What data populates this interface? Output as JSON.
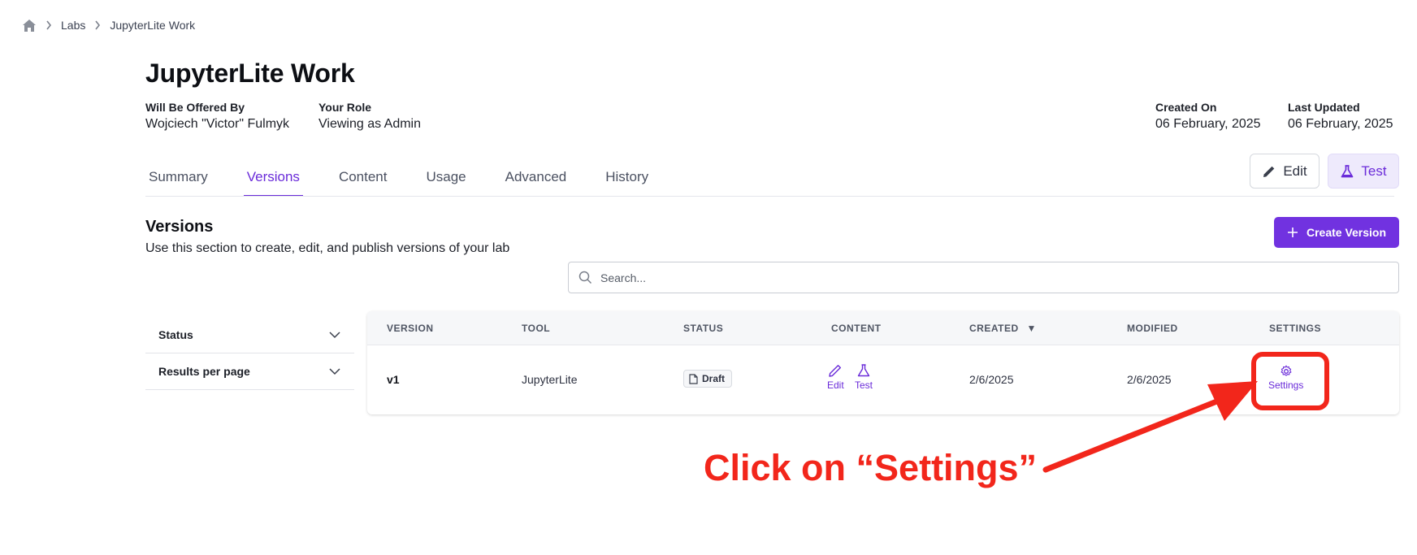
{
  "breadcrumb": {
    "home_icon": "home-icon",
    "items": [
      "Labs",
      "JupyterLite Work"
    ]
  },
  "page": {
    "title": "JupyterLite Work"
  },
  "meta": {
    "offered_by_label": "Will Be Offered By",
    "offered_by_value": "Wojciech \"Victor\" Fulmyk",
    "role_label": "Your Role",
    "role_value": "Viewing as Admin",
    "created_label": "Created On",
    "created_value": "06 February, 2025",
    "updated_label": "Last Updated",
    "updated_value": "06 February, 2025"
  },
  "tabs": [
    {
      "label": "Summary",
      "active": false
    },
    {
      "label": "Versions",
      "active": true
    },
    {
      "label": "Content",
      "active": false
    },
    {
      "label": "Usage",
      "active": false
    },
    {
      "label": "Advanced",
      "active": false
    },
    {
      "label": "History",
      "active": false
    }
  ],
  "header_actions": {
    "edit_label": "Edit",
    "test_label": "Test"
  },
  "versions_section": {
    "title": "Versions",
    "subtitle": "Use this section to create, edit, and publish versions of your lab",
    "create_label": "Create Version",
    "search_placeholder": "Search..."
  },
  "filters": {
    "status_label": "Status",
    "results_label": "Results per page"
  },
  "table": {
    "headers": [
      "VERSION",
      "TOOL",
      "STATUS",
      "CONTENT",
      "CREATED",
      "MODIFIED",
      "SETTINGS"
    ],
    "sort_indicator": "▼",
    "rows": [
      {
        "version": "v1",
        "tool": "JupyterLite",
        "status": "Draft",
        "content_edit": "Edit",
        "content_test": "Test",
        "created": "2/6/2025",
        "modified": "2/6/2025",
        "settings": "Settings"
      }
    ]
  },
  "annotation": {
    "callout": "Click on “Settings”",
    "color": "#f2261b"
  },
  "colors": {
    "accent": "#6a2bd9",
    "primary_button": "#7132e0"
  }
}
